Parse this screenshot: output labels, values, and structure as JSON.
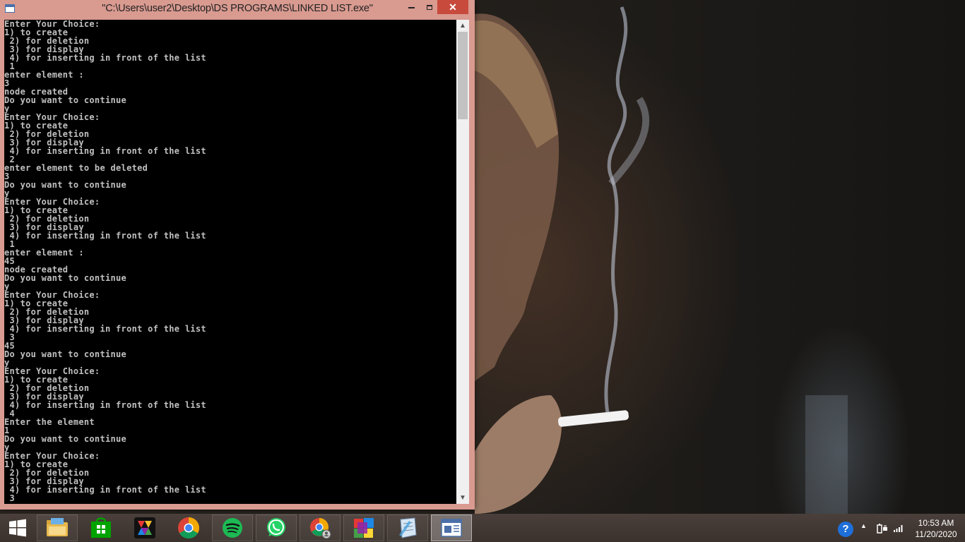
{
  "window": {
    "title": "\"C:\\Users\\user2\\Desktop\\DS PROGRAMS\\LINKED LIST.exe\"",
    "close_symbol": "✕"
  },
  "console": {
    "lines": [
      "Enter Your Choice:",
      "1) to create",
      " 2) for deletion",
      " 3) for display",
      " 4) for inserting in front of the list",
      " 1",
      "enter element :",
      "3",
      "node created",
      "Do you want to continue",
      "y",
      "Enter Your Choice:",
      "1) to create",
      " 2) for deletion",
      " 3) for display",
      " 4) for inserting in front of the list",
      " 2",
      "enter element to be deleted",
      "3",
      "Do you want to continue",
      "y",
      "Enter Your Choice:",
      "1) to create",
      " 2) for deletion",
      " 3) for display",
      " 4) for inserting in front of the list",
      " 1",
      "enter element :",
      "45",
      "node created",
      "Do you want to continue",
      "y",
      "Enter Your Choice:",
      "1) to create",
      " 2) for deletion",
      " 3) for display",
      " 4) for inserting in front of the list",
      " 3",
      "45",
      "Do you want to continue",
      "y",
      "Enter Your Choice:",
      "1) to create",
      " 2) for deletion",
      " 3) for display",
      " 4) for inserting in front of the list",
      " 4",
      "Enter the element",
      "1",
      "Do you want to continue",
      "y",
      "Enter Your Choice:",
      "1) to create",
      " 2) for deletion",
      " 3) for display",
      " 4) for inserting in front of the list",
      " 3"
    ]
  },
  "taskbar": {
    "items": [
      {
        "icon": "file-explorer-icon"
      },
      {
        "icon": "windows-store-icon"
      },
      {
        "icon": "colorful-app-icon"
      },
      {
        "icon": "chrome-icon"
      },
      {
        "icon": "spotify-icon"
      },
      {
        "icon": "whatsapp-icon"
      },
      {
        "icon": "chrome-profile-icon"
      },
      {
        "icon": "tiles-app-icon"
      },
      {
        "icon": "notepad-app-icon"
      },
      {
        "icon": "console-app-icon"
      }
    ],
    "tray": {
      "help_symbol": "?",
      "time": "10:53 AM",
      "date": "11/20/2020"
    }
  },
  "colors": {
    "title_bar": "#d99a90",
    "close_button": "#c74a3c",
    "console_bg": "#000000",
    "console_text": "#c0c0c0",
    "taskbar": "#3f3530"
  }
}
